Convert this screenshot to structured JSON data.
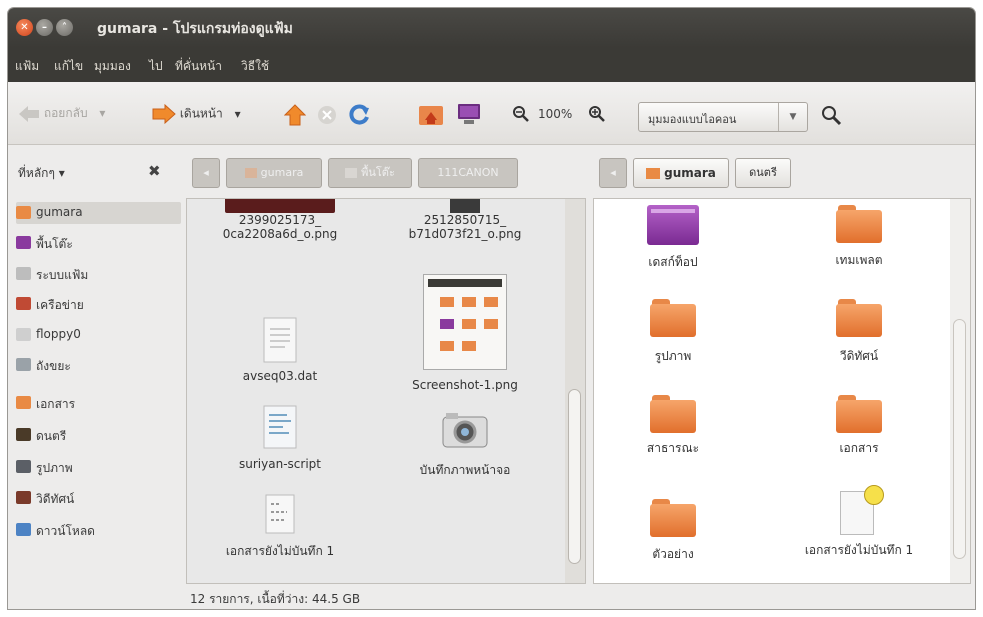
{
  "window": {
    "title": "gumara - โปรแกรมท่องดูแฟ้ม"
  },
  "menu": [
    "แฟ้ม",
    "แก้ไข",
    "มุมมอง",
    "ไป",
    "ที่คั่นหน้า",
    "วิธีใช้"
  ],
  "toolbar": {
    "back_label": "ถอยกลับ",
    "forward_label": "เดินหน้า",
    "zoom_level": "100%",
    "view_mode": "มุมมองแบบไอคอน"
  },
  "places": {
    "header": "ที่หลักๆ",
    "items": [
      {
        "label": "gumara",
        "icon": "home-folder-icon",
        "color": "#e98a44"
      },
      {
        "label": "พื้นโต๊ะ",
        "icon": "desktop-icon",
        "color": "#8a3a9e"
      },
      {
        "label": "ระบบแฟ้ม",
        "icon": "harddisk-icon",
        "color": "#bdbdbd"
      },
      {
        "label": "เครือข่าย",
        "icon": "network-icon",
        "color": "#c04a34"
      },
      {
        "label": "floppy0",
        "icon": "floppy-icon",
        "color": "#cfcfcf"
      },
      {
        "label": "ถังขยะ",
        "icon": "trash-icon",
        "color": "#9aa2a8"
      },
      {
        "label": "เอกสาร",
        "icon": "documents-folder-icon",
        "color": "#e98a44"
      },
      {
        "label": "ดนตรี",
        "icon": "music-folder-icon",
        "color": "#4a3a28"
      },
      {
        "label": "รูปภาพ",
        "icon": "pictures-folder-icon",
        "color": "#5b5f66"
      },
      {
        "label": "วิดีทัศน์",
        "icon": "videos-folder-icon",
        "color": "#7a3a2a"
      },
      {
        "label": "ดาวน์โหลด",
        "icon": "downloads-folder-icon",
        "color": "#4d83c4"
      }
    ]
  },
  "left_pane": {
    "breadcrumbs": [
      "gumara",
      "พื้นโต๊ะ",
      "111CANON"
    ],
    "files": [
      {
        "name1": "2399025173_",
        "name2": "0ca2208a6d_o.png"
      },
      {
        "name1": "2512850715_",
        "name2": "b71d073f21_o.png"
      },
      {
        "name1": "avseq03.dat",
        "name2": ""
      },
      {
        "name1": "Screenshot-1.png",
        "name2": ""
      },
      {
        "name1": "suriyan-script",
        "name2": ""
      },
      {
        "name1": "บันทึกภาพหน้าจอ",
        "name2": ""
      },
      {
        "name1": "เอกสารยังไม่บันทึก 1",
        "name2": ""
      }
    ]
  },
  "right_pane": {
    "breadcrumbs": [
      "gumara",
      "ดนตรี"
    ],
    "items": [
      {
        "name": "เดสก์ท็อป"
      },
      {
        "name": "เทมเพลต"
      },
      {
        "name": "รูปภาพ"
      },
      {
        "name": "วีดิทัศน์"
      },
      {
        "name": "สาธารณะ"
      },
      {
        "name": "เอกสาร"
      },
      {
        "name": "ตัวอย่าง"
      },
      {
        "name": "เอกสารยังไม่บันทึก 1"
      }
    ]
  },
  "status": "12 รายการ, เนื้อที่ว่าง: 44.5 GB"
}
